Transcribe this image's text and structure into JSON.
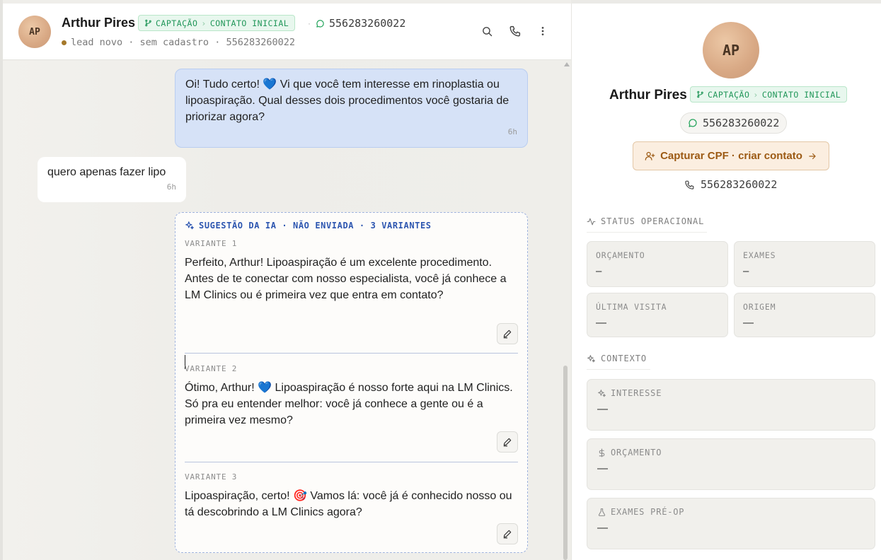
{
  "contact": {
    "initials": "AP",
    "name": "Arthur Pires",
    "phone": "556283260022"
  },
  "stage": {
    "stage_from": "CAPTAÇÃO",
    "stage_to": "CONTATO INICIAL"
  },
  "header": {
    "subtitle": "lead novo · sem cadastro · 556283260022"
  },
  "messages": {
    "outgoing_text": "Oi! Tudo certo! 💙 Vi que você tem interesse em rinoplastia ou lipoaspiração. Qual desses dois procedimentos você gostaria de priorizar agora?",
    "outgoing_time": "6h",
    "incoming_text": "quero apenas fazer lipo",
    "incoming_time": "6h"
  },
  "ai_suggestion": {
    "header": "SUGESTÃO DA IA · NÃO ENVIADA · 3 VARIANTES",
    "variants": [
      {
        "label": "VARIANTE 1",
        "text": "Perfeito, Arthur! Lipoaspiração é um excelente procedimento. Antes de te conectar com nosso especialista, você já conhece a LM Clinics ou é primeira vez que entra em contato?"
      },
      {
        "label": "VARIANTE 2",
        "text": "Ótimo, Arthur! 💙 Lipoaspiração é nosso forte aqui na LM Clinics. Só pra eu entender melhor: você já conhece a gente ou é a primeira vez mesmo?"
      },
      {
        "label": "VARIANTE 3",
        "text": "Lipoaspiração, certo! 🎯 Vamos lá: você já é conhecido nosso ou tá descobrindo a LM Clinics agora?"
      }
    ]
  },
  "profile": {
    "capture_label": "Capturar CPF · criar contato",
    "status_title": "STATUS OPERACIONAL",
    "status_cards": [
      {
        "key": "ORÇAMENTO",
        "value": "–"
      },
      {
        "key": "EXAMES",
        "value": "–"
      },
      {
        "key": "ÚLTIMA VISITA",
        "value": "—"
      },
      {
        "key": "ORIGEM",
        "value": "—"
      }
    ],
    "context_title": "CONTEXTO",
    "context_cards": [
      {
        "key": "INTERESSE",
        "value": "—"
      },
      {
        "key": "ORÇAMENTO",
        "value": "—"
      },
      {
        "key": "EXAMES PRÉ-OP",
        "value": "—"
      }
    ]
  },
  "icons": {
    "whatsapp": "whatsapp-icon",
    "search": "search-icon",
    "call": "phone-icon",
    "more": "more-vertical-icon",
    "sparkle": "sparkle-icon",
    "edit": "pencil-icon",
    "add_user": "user-plus-icon",
    "activity": "activity-icon",
    "dollar": "dollar-icon",
    "flask": "flask-icon",
    "branch": "git-branch-icon"
  },
  "colors": {
    "stage_green": "#22975a",
    "ai_blue": "#2d56b0",
    "outgoing_bubble": "#d6e2f7",
    "capture_orange": "#9c5a14"
  }
}
